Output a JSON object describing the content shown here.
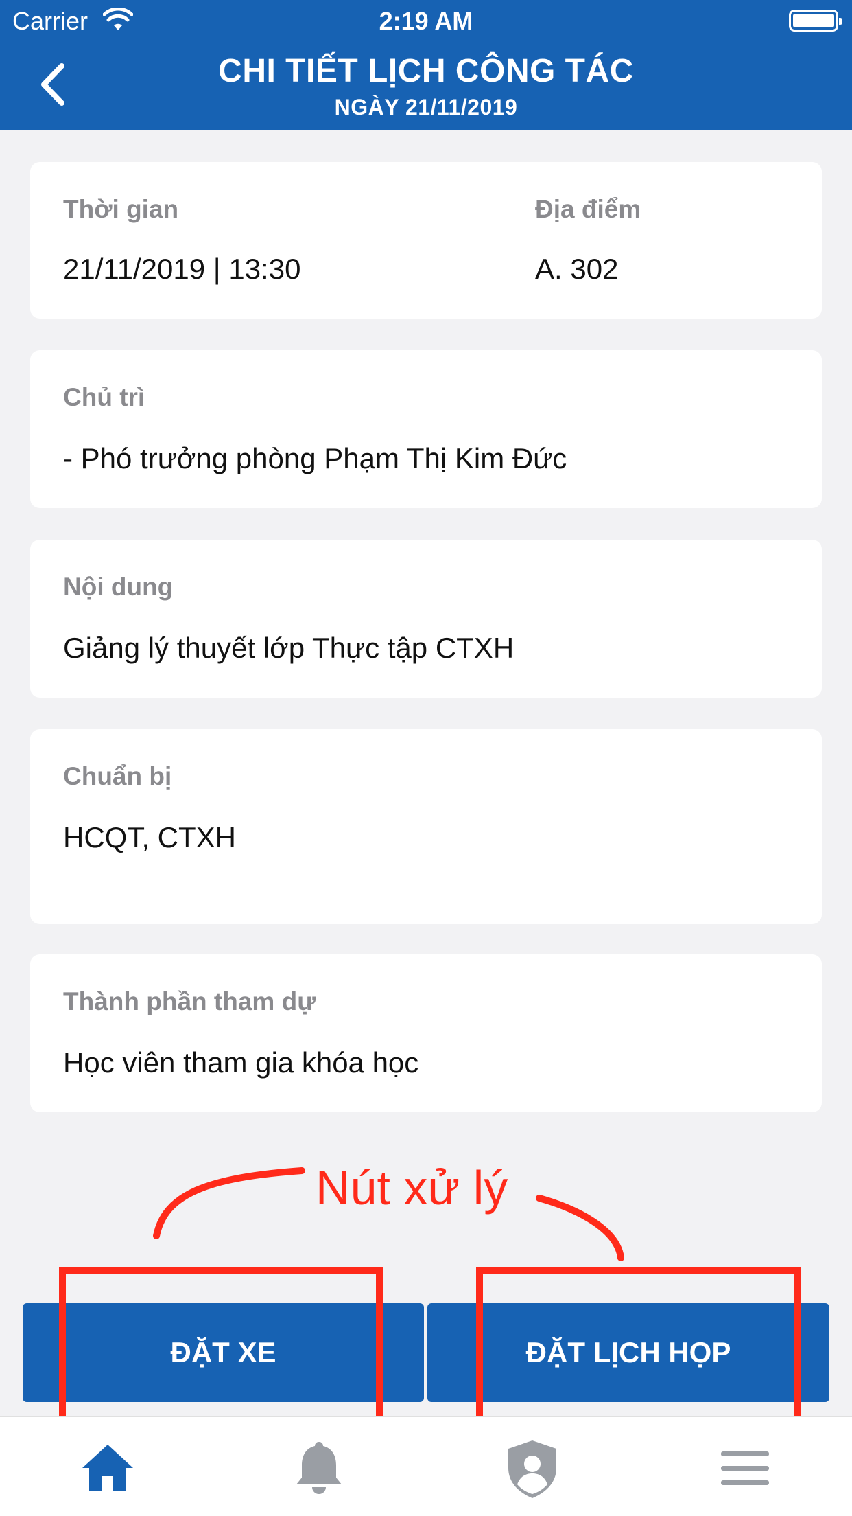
{
  "status_bar": {
    "carrier": "Carrier",
    "time": "2:19 AM"
  },
  "header": {
    "title": "CHI TIẾT LỊCH CÔNG TÁC",
    "subtitle": "NGÀY 21/11/2019"
  },
  "details": {
    "time_label": "Thời gian",
    "time_value": "21/11/2019 | 13:30",
    "location_label": "Địa điểm",
    "location_value": "A. 302",
    "host_label": "Chủ trì",
    "host_value": "- Phó trưởng phòng Phạm Thị Kim Đức",
    "content_label": "Nội dung",
    "content_value": "Giảng lý thuyết lớp Thực tập CTXH",
    "prepare_label": "Chuẩn bị",
    "prepare_value": "HCQT, CTXH",
    "participants_label": "Thành phần tham dự",
    "participants_value": "Học viên tham gia khóa học"
  },
  "annotation": {
    "text": "Nút xử lý",
    "color": "#ff2a1a"
  },
  "actions": {
    "book_car": "ĐẶT XE",
    "book_meeting": "ĐẶT LỊCH HỌP"
  },
  "tabbar": {
    "tabs": [
      {
        "icon": "home-icon",
        "active": true
      },
      {
        "icon": "bell-icon",
        "active": false
      },
      {
        "icon": "user-shield-icon",
        "active": false
      },
      {
        "icon": "menu-icon",
        "active": false
      }
    ]
  },
  "colors": {
    "primary": "#1762b3",
    "background": "#f2f2f4",
    "label": "#8a8a8e",
    "inactive_icon": "#9a9ea4"
  }
}
